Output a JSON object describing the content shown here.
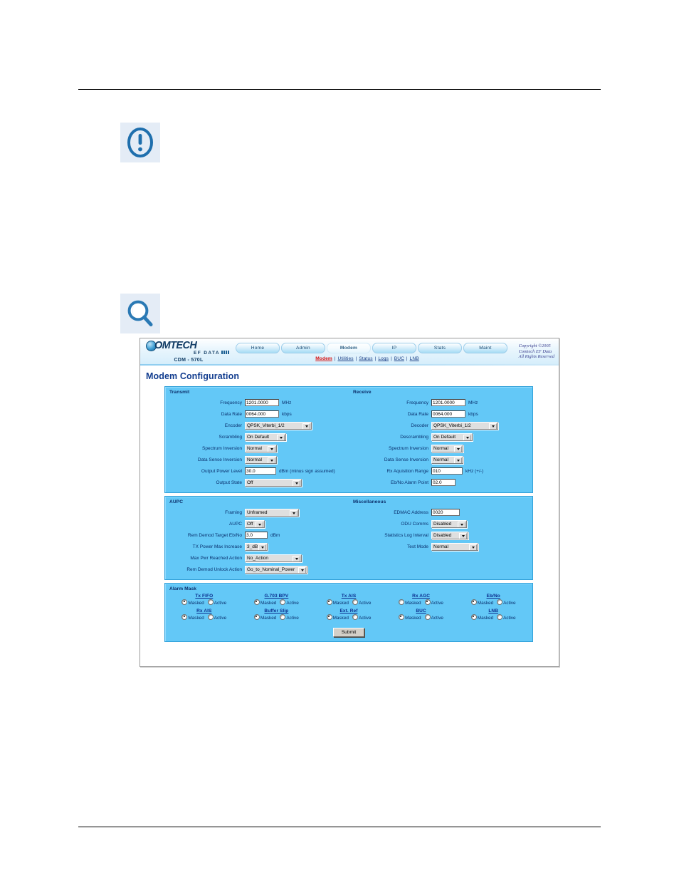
{
  "app": {
    "brand": {
      "globe_icon": "globe-icon",
      "word": "OMTECH",
      "sub": "EF DATA",
      "model": "CDM - 570L"
    },
    "copyright": {
      "line1": "Copyright ©2005",
      "line2": "Comtech EF Data",
      "line3": "All Rights Reserved"
    },
    "tabs": [
      {
        "label": "Home",
        "active": false
      },
      {
        "label": "Admin",
        "active": false
      },
      {
        "label": "Modem",
        "active": true
      },
      {
        "label": "IP",
        "active": false
      },
      {
        "label": "Stats",
        "active": false
      },
      {
        "label": "Maint",
        "active": false
      }
    ],
    "subnav": [
      {
        "label": "Modem",
        "current": true
      },
      {
        "label": "Utilities",
        "current": false
      },
      {
        "label": "Status",
        "current": false
      },
      {
        "label": "Logs",
        "current": false
      },
      {
        "label": "BUC",
        "current": false
      },
      {
        "label": "LNB",
        "current": false
      }
    ],
    "page_title": "Modem Configuration",
    "colors": {
      "panel_blue": "#63c8f7",
      "panel_border": "#2f9fd8",
      "label_blue": "#09306e",
      "title_blue": "#123d8f",
      "link_red": "#d81212",
      "link_blue": "#1b3f86"
    }
  },
  "transmit": {
    "title": "Transmit",
    "frequency": {
      "label": "Frequency",
      "value": "1201.0000",
      "unit": "MHz"
    },
    "data_rate": {
      "label": "Data Rate",
      "value": "0064.000",
      "unit": "kbps"
    },
    "encoder": {
      "label": "Encoder",
      "value": "QPSK_Viterbi_1/2"
    },
    "scrambling": {
      "label": "Scrambling",
      "value": "On Default"
    },
    "spectrum_inversion": {
      "label": "Spectrum Inversion",
      "value": "Normal"
    },
    "data_sense_inversion": {
      "label": "Data Sense Inversion",
      "value": "Normal"
    },
    "output_power_level": {
      "label": "Output Power Level",
      "value": "30.0",
      "unit": "dBm (minus sign assumed)"
    },
    "output_state": {
      "label": "Output State",
      "value": "Off"
    }
  },
  "receive": {
    "title": "Receive",
    "frequency": {
      "label": "Frequency",
      "value": "1201.0000",
      "unit": "MHz"
    },
    "data_rate": {
      "label": "Data Rate",
      "value": "0064.000",
      "unit": "kbps"
    },
    "decoder": {
      "label": "Decoder",
      "value": "QPSK_Viterbi_1/2"
    },
    "descrambling": {
      "label": "Descrambling",
      "value": "On Default"
    },
    "spectrum_inversion": {
      "label": "Spectrum Inversion",
      "value": "Normal"
    },
    "data_sense_inversion": {
      "label": "Data Sense Inversion",
      "value": "Normal"
    },
    "rx_acquisition_range": {
      "label": "Rx Aquisition Range",
      "value": "010",
      "unit": "kHz (+/-)"
    },
    "ebno_alarm_point": {
      "label": "Eb/No Alarm Point",
      "value": "02.0",
      "unit": ""
    }
  },
  "aupc": {
    "title": "AUPC",
    "framing": {
      "label": "Framing",
      "value": "Unframed"
    },
    "aupc": {
      "label": "AUPC",
      "value": "Off"
    },
    "rem_demod_target": {
      "label": "Rem Demod Target Eb/No",
      "value": "3.0",
      "unit": "dBm"
    },
    "tx_power_max_increase": {
      "label": "TX Power Max Increase",
      "value": "3_dB"
    },
    "max_pwr_reached_action": {
      "label": "Max Pwr Reached Action",
      "value": "No_Action"
    },
    "rem_demod_unlock_action": {
      "label": "Rem Demod Unlock Action",
      "value": "Go_to_Nominal_Power"
    }
  },
  "misc": {
    "title": "Miscellaneous",
    "edmac_address": {
      "label": "EDMAC Address",
      "value": "0020"
    },
    "odu_comms": {
      "label": "ODU Comms",
      "value": "Disabled"
    },
    "statistics_log_interval": {
      "label": "Statistics Log Interval",
      "value": "Disabled"
    },
    "test_mode": {
      "label": "Test Mode",
      "value": "Normal"
    }
  },
  "alarm_mask": {
    "title": "Alarm Mask",
    "option_masked": "Masked",
    "option_active": "Active",
    "row1": [
      {
        "name": "Tx FIFO",
        "selected": "Masked"
      },
      {
        "name": "G.703 BPV",
        "selected": "Masked"
      },
      {
        "name": "Tx AIS",
        "selected": "Masked"
      },
      {
        "name": "Rx AGC",
        "selected": "Active"
      },
      {
        "name": "Eb/No",
        "selected": "Masked"
      }
    ],
    "row2": [
      {
        "name": "Rx AIS",
        "selected": "Masked"
      },
      {
        "name": "Buffer Slip",
        "selected": "Masked"
      },
      {
        "name": "Ext. Ref",
        "selected": "Masked"
      },
      {
        "name": "BUC",
        "selected": "Masked"
      },
      {
        "name": "LNB",
        "selected": "Masked"
      }
    ],
    "submit_label": "Submit"
  },
  "document": {
    "note_icon": "exclamation-circle-icon",
    "magnifier_icon": "magnifier-icon"
  }
}
